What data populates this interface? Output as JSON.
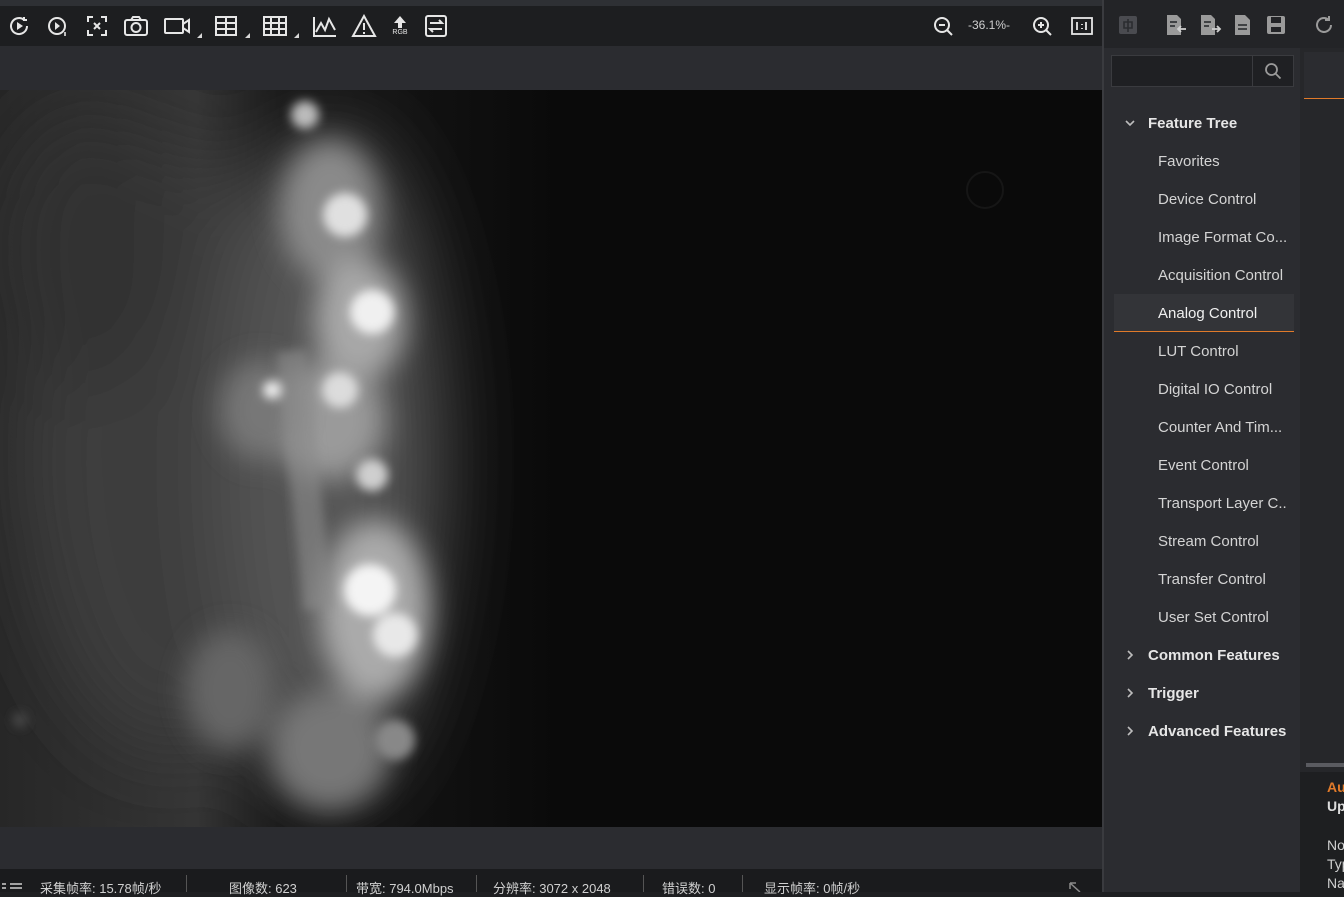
{
  "toolbar": {
    "zoom_readout": "-36.1%-",
    "rgb_label": "RGB"
  },
  "status": {
    "acq_frame_rate": "采集帧率: 15.78帧/秒",
    "image_count": "图像数: 623",
    "bandwidth": "带宽: 794.0Mbps",
    "resolution": "分辨率: 3072 x 2048",
    "error_count": "错误数: 0",
    "display_frame_rate": "显示帧率: 0帧/秒"
  },
  "search": {
    "placeholder": ""
  },
  "tree": {
    "feature_tree": "Feature Tree",
    "items": [
      "Favorites",
      "Device Control",
      "Image Format Co...",
      "Acquisition Control",
      "Analog Control",
      "LUT Control",
      "Digital IO Control",
      "Counter And Tim...",
      "Event Control",
      "Transport Layer C...",
      "Stream Control",
      "Transfer Control",
      "User Set Control"
    ],
    "selected": "Analog Control",
    "common_features": "Common Features",
    "trigger": "Trigger",
    "advanced_features": "Advanced Features"
  },
  "far_panel": {
    "line1": "Au",
    "line2": "Up",
    "line3": "No",
    "line4": "Typ",
    "line5": "Na"
  },
  "colors": {
    "accent": "#e07a2a",
    "panel": "#2b2c30",
    "toolbar": "#1d1e20"
  }
}
